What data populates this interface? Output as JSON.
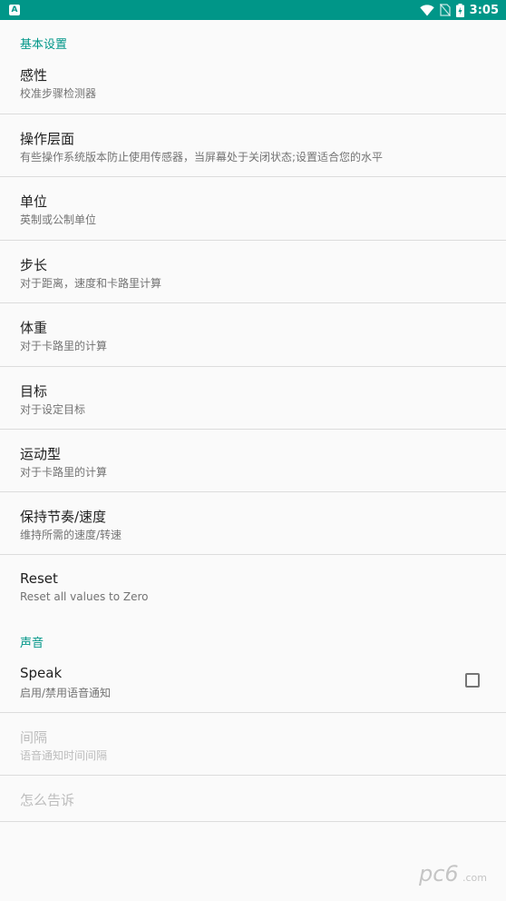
{
  "status_bar": {
    "app_icon_letter": "A",
    "time": "3:05",
    "battery_level": "charging"
  },
  "sections": {
    "basic_header": "基本设置",
    "sound_header": "声音"
  },
  "prefs": {
    "sensitivity": {
      "title": "感性",
      "summary": "校准步骤检测器"
    },
    "operation": {
      "title": "操作层面",
      "summary": "有些操作系统版本防止使用传感器，当屏幕处于关闭状态;设置适合您的水平"
    },
    "unit": {
      "title": "单位",
      "summary": "英制或公制单位"
    },
    "step_length": {
      "title": "步长",
      "summary": "对于距离，速度和卡路里计算"
    },
    "weight": {
      "title": "体重",
      "summary": "对于卡路里的计算"
    },
    "goal": {
      "title": "目标",
      "summary": "对于设定目标"
    },
    "exercise_type": {
      "title": "运动型",
      "summary": "对于卡路里的计算"
    },
    "pace": {
      "title": "保持节奏/速度",
      "summary": "维持所需的速度/转速"
    },
    "reset": {
      "title": "Reset",
      "summary": "Reset all values to Zero"
    },
    "speak": {
      "title": "Speak",
      "summary": "启用/禁用语音通知",
      "checked": false
    },
    "interval": {
      "title": "间隔",
      "summary": "语音通知时间间隔"
    },
    "how_to_tell": {
      "title": "怎么告诉"
    }
  },
  "colors": {
    "accent": "#009688",
    "text_primary": "#212121",
    "text_secondary": "#737373",
    "text_disabled": "#bdbdbd",
    "background": "#fafafa"
  },
  "watermark": {
    "text": "pc6",
    "subtext": ".com"
  }
}
